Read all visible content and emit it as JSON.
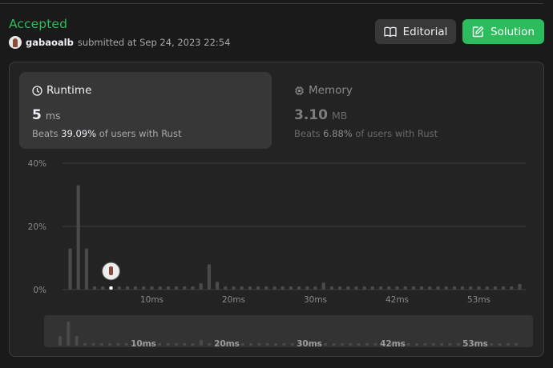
{
  "header": {
    "status": "Accepted",
    "username": "gabaoalb",
    "submitted_text": "submitted at Sep 24, 2023 22:54"
  },
  "buttons": {
    "editorial": "Editorial",
    "solution": "Solution"
  },
  "runtime": {
    "label": "Runtime",
    "value": "5",
    "unit": "ms",
    "beats_prefix": "Beats",
    "beats_pct": "39.09%",
    "beats_suffix": "of users with Rust"
  },
  "memory": {
    "label": "Memory",
    "value": "3.10",
    "unit": "MB",
    "beats_prefix": "Beats",
    "beats_pct": "6.88%",
    "beats_suffix": "of users with Rust"
  },
  "colors": {
    "accepted": "#2cbb5d",
    "solution_button": "#2cbb5d",
    "bar": "#4a4a4a",
    "marker_dot": "#ffffff"
  },
  "chart_data": {
    "type": "bar",
    "title": "",
    "xlabel": "",
    "ylabel": "",
    "ylim": [
      0,
      40
    ],
    "y_ticks": [
      "0%",
      "20%",
      "40%"
    ],
    "x_ticks": [
      "10ms",
      "20ms",
      "30ms",
      "42ms",
      "53ms"
    ],
    "x_tick_indices": [
      10,
      20,
      30,
      40,
      50
    ],
    "grid": true,
    "your_submission_index": 5,
    "values": [
      13,
      33,
      13,
      1,
      1,
      1,
      1,
      1,
      1,
      1,
      1,
      1,
      1,
      1,
      1,
      1,
      2,
      8,
      2.5,
      1,
      1,
      1,
      1,
      1,
      1,
      1,
      1,
      1,
      1,
      1,
      1,
      2.2,
      1,
      1,
      1,
      1,
      1,
      1,
      1,
      1,
      1,
      1,
      1,
      1,
      1,
      1,
      1,
      1,
      1,
      1,
      1,
      1,
      1,
      1,
      1,
      1.8
    ]
  },
  "overview_ticks": [
    "10ms",
    "20ms",
    "30ms",
    "42ms",
    "53ms"
  ]
}
